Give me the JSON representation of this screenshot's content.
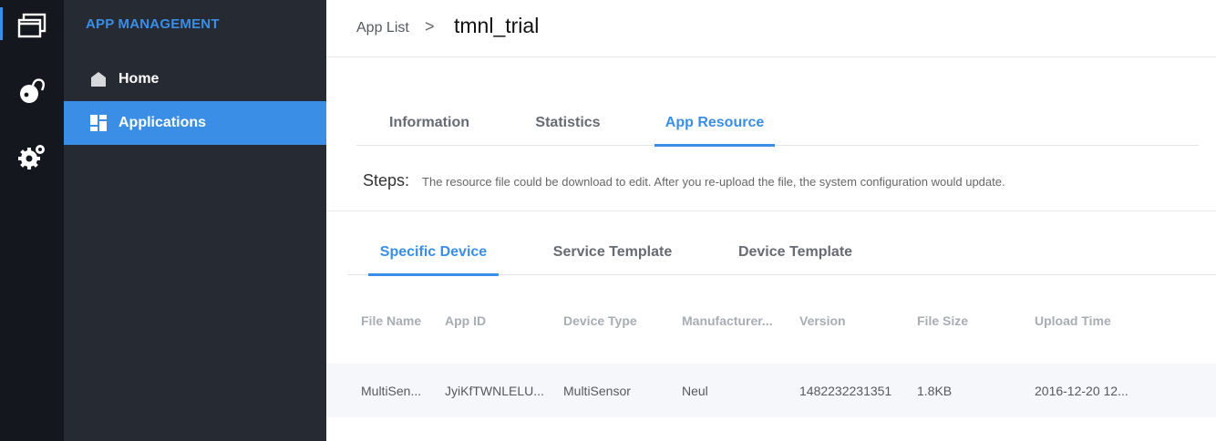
{
  "rail": {
    "items": [
      {
        "icon": "window-stack-icon"
      },
      {
        "icon": "ball-pin-icon"
      },
      {
        "icon": "gear-icon"
      }
    ]
  },
  "sidebar": {
    "title": "APP MANAGEMENT",
    "items": [
      {
        "label": "Home",
        "icon": "home-icon"
      },
      {
        "label": "Applications",
        "icon": "grid-icon"
      }
    ]
  },
  "breadcrumb": {
    "parent": "App List",
    "separator": ">",
    "current": "tmnl_trial"
  },
  "tabs": {
    "primary": [
      "Information",
      "Statistics",
      "App Resource"
    ],
    "primary_active": "App Resource",
    "secondary": [
      "Specific Device",
      "Service Template",
      "Device Template"
    ],
    "secondary_active": "Specific Device"
  },
  "steps": {
    "label": "Steps:",
    "text": "The resource file could be download to edit. After you re-upload the file, the system configuration would update."
  },
  "table": {
    "columns": [
      "File Name",
      "App ID",
      "Device Type",
      "Manufacturer...",
      "Version",
      "File Size",
      "Upload Time"
    ],
    "rows": [
      [
        "MultiSen...",
        "JyiKfTWNLELU...",
        "MultiSensor",
        "Neul",
        "1482232231351",
        "1.8KB",
        "2016-12-20 12..."
      ]
    ]
  },
  "colors": {
    "accent": "#3a8ee6",
    "rail_bg": "#14171d",
    "sidebar_bg": "#252a33"
  }
}
